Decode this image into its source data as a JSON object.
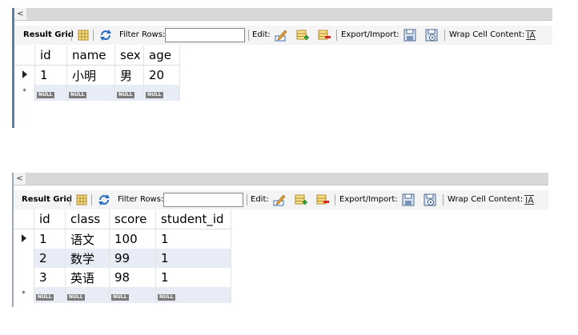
{
  "toolbar": {
    "result_grid_label": "Result Grid",
    "filter_rows_label": "Filter Rows:",
    "filter_value": "",
    "edit_label": "Edit:",
    "export_import_label": "Export/Import:",
    "wrap_cell_label": "Wrap Cell Content:",
    "icons": [
      "grid-view-icon",
      "refresh-icon",
      "edit-cell-icon",
      "add-row-icon",
      "delete-row-icon",
      "export-icon",
      "import-icon",
      "wrap-text-icon"
    ],
    "scroll_arrow": "<"
  },
  "grid1": {
    "columns": [
      "id",
      "name",
      "sex",
      "age"
    ],
    "rows": [
      [
        "1",
        "小明",
        "男",
        "20"
      ]
    ],
    "null_label": "NULL",
    "new_row_marker": "*"
  },
  "grid2": {
    "columns": [
      "id",
      "class",
      "score",
      "student_id"
    ],
    "rows": [
      [
        "1",
        "语文",
        "100",
        "1"
      ],
      [
        "2",
        "数学",
        "99",
        "1"
      ],
      [
        "3",
        "英语",
        "98",
        "1"
      ]
    ],
    "null_label": "NULL",
    "new_row_marker": "*"
  },
  "colors": {
    "accent_bar": "#5b7fa6",
    "alt_row": "#e8ecf7",
    "null_badge": "#7a7a7a"
  }
}
